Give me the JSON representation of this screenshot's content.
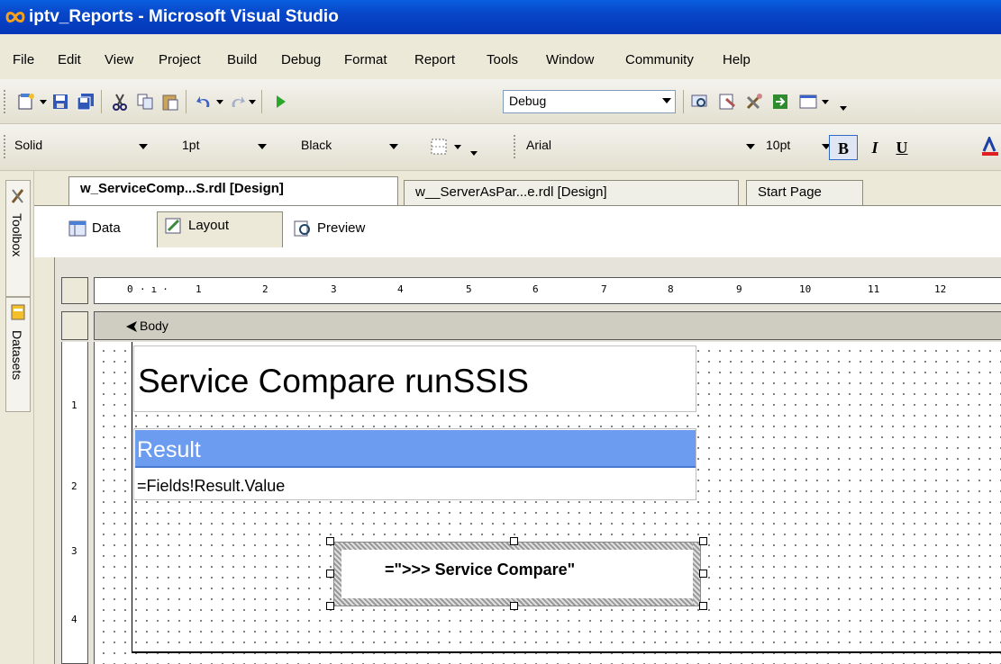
{
  "window": {
    "title": "iptv_Reports - Microsoft Visual Studio",
    "icon": "visual-studio-icon"
  },
  "menu": [
    "File",
    "Edit",
    "View",
    "Project",
    "Build",
    "Debug",
    "Format",
    "Report",
    "Tools",
    "Window",
    "Community",
    "Help"
  ],
  "toolbar1": {
    "config": "Debug"
  },
  "toolbar2": {
    "border_style": "Solid",
    "border_width": "1pt",
    "border_color": "Black",
    "font": "Arial",
    "font_size": "10pt",
    "bold": "B",
    "italic": "I",
    "underline": "U"
  },
  "left_panel": {
    "toolbox": "Toolbox",
    "datasets": "Datasets"
  },
  "doc_tabs": [
    "w_ServiceComp...S.rdl [Design]",
    "w__ServerAsPar...e.rdl [Design]",
    "Start Page"
  ],
  "design_tabs": [
    "Data",
    "Layout",
    "Preview"
  ],
  "ruler": {
    "h": [
      "0",
      "1",
      "2",
      "3",
      "4",
      "5",
      "6",
      "7",
      "8",
      "9",
      "10",
      "11",
      "12"
    ],
    "v": [
      "1",
      "2",
      "3",
      "4"
    ]
  },
  "body_label": "Body",
  "report": {
    "title": "Service Compare  runSSIS",
    "header": "Result",
    "field": "=Fields!Result.Value",
    "textbox": "=\">>>   Service Compare\""
  }
}
